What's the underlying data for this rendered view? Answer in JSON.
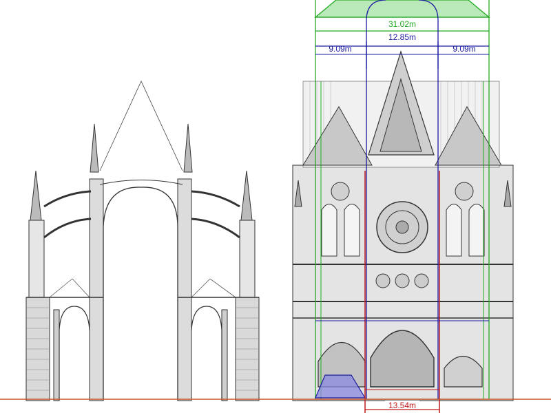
{
  "drawings": {
    "left": {
      "icon": "cathedral-cross-section-drawing"
    },
    "right": {
      "icon": "cathedral-west-facade-drawing"
    }
  },
  "dimensions": {
    "total_width": {
      "text": "31.02m",
      "color": "#22aa22"
    },
    "nave_width": {
      "text": "12.85m",
      "color": "#1a1aa0"
    },
    "left_aisle": {
      "text": "9.09m",
      "color": "#1a1aa0"
    },
    "right_aisle": {
      "text": "9.09m",
      "color": "#1a1aa0"
    },
    "portal_width": {
      "text": "13.54m",
      "color": "#c01818"
    }
  },
  "colors": {
    "ground_line": "#c8502a",
    "green_overlay": "#22aa22",
    "blue_overlay": "#1a1aa0",
    "red_overlay": "#c01818",
    "green_fill": "#b9e8b9",
    "blue_fill": "#8a8ae0",
    "ink": "#222222"
  }
}
